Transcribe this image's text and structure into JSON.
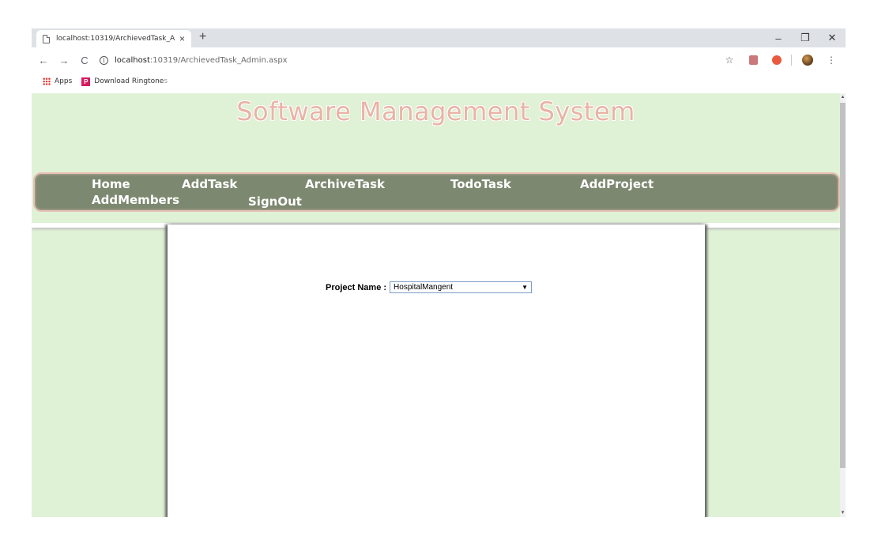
{
  "browser": {
    "tab_title": "localhost:10319/ArchievedTask_A",
    "tab_close": "×",
    "new_tab": "+",
    "window_controls": {
      "minimize": "–",
      "restore": "❐",
      "close": "✕"
    },
    "nav": {
      "back": "←",
      "forward": "→",
      "reload": "C"
    },
    "url_host": "localhost",
    "url_rest": ":10319/ArchievedTask_Admin.aspx",
    "info_glyph": "i",
    "star": "☆",
    "menu": "⋮",
    "bookmarks": [
      {
        "label": "Apps"
      },
      {
        "label": "Download Ringtone",
        "faded_suffix": "s"
      }
    ],
    "bookmark_p": "P"
  },
  "page": {
    "site_title": "Software Management System",
    "menu": [
      {
        "label": "Home"
      },
      {
        "label": "AddTask"
      },
      {
        "label": "ArchiveTask"
      },
      {
        "label": "TodoTask"
      },
      {
        "label": "AddProject"
      },
      {
        "label": "AddMembers"
      },
      {
        "label": "SignOut"
      }
    ],
    "form": {
      "project_label": "Project Name :",
      "project_value": "HospitalMangent",
      "select_arrow": "▼"
    }
  },
  "colors": {
    "page_bg": "#dff2d6",
    "menubar_bg": "#7d8870",
    "menubar_border": "#e8c1b4",
    "title_color": "#e9b3a5"
  }
}
